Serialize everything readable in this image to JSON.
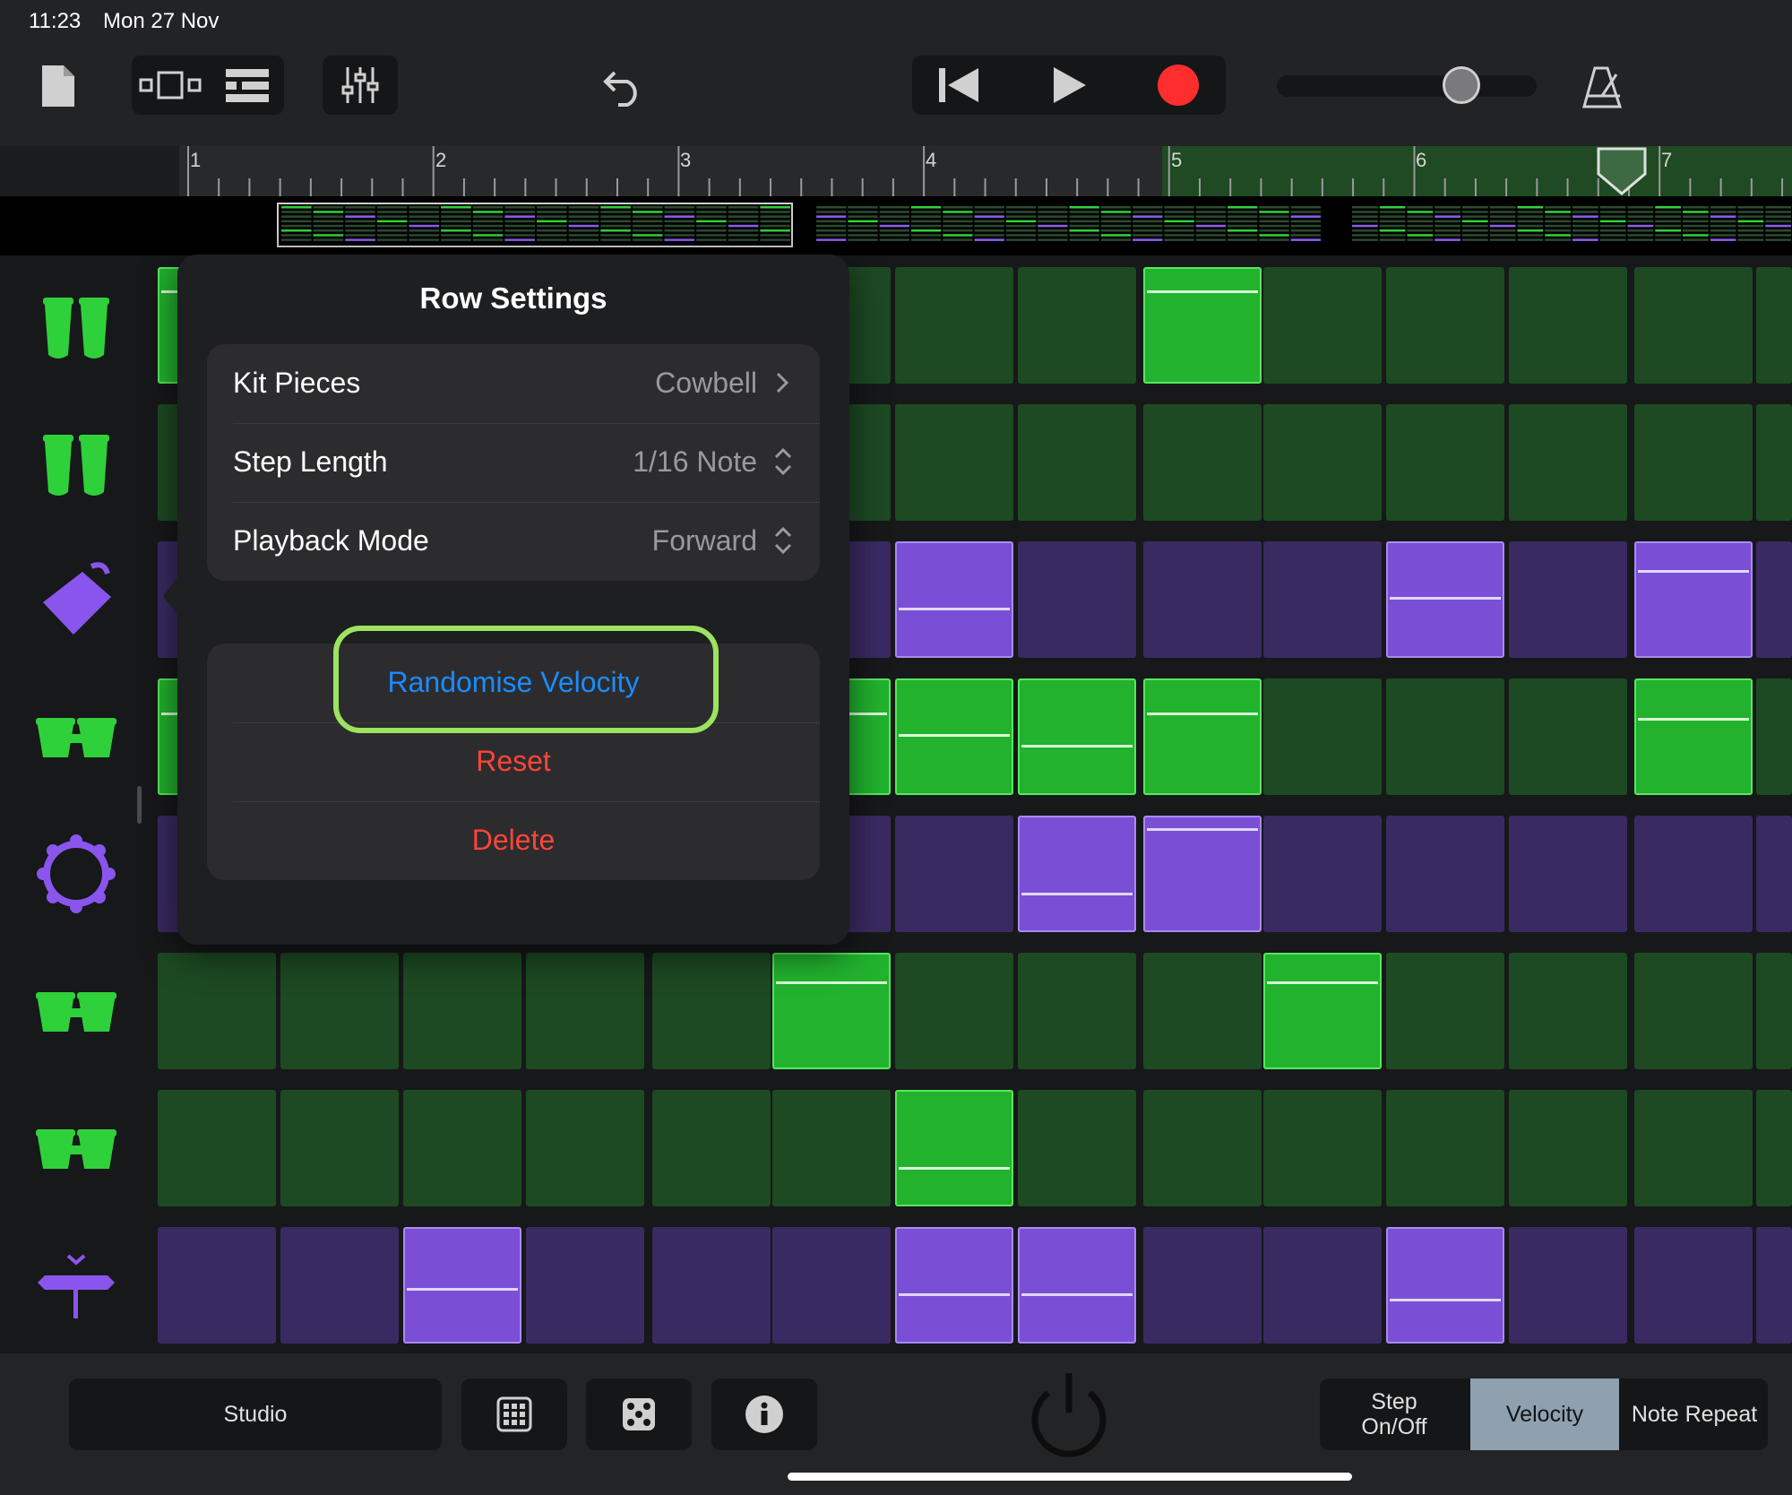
{
  "status": {
    "time": "11:23",
    "date": "Mon 27 Nov"
  },
  "toolbar": {
    "icons": [
      "document-icon",
      "view-toggle-icon",
      "tracks-icon",
      "mixer-icon",
      "undo-icon",
      "rewind-icon",
      "play-icon",
      "record-icon",
      "volume-slider",
      "metronome-icon"
    ],
    "record_color": "#ff2d2d"
  },
  "ruler": {
    "bars": [
      "1",
      "2",
      "3",
      "4",
      "5",
      "6",
      "7"
    ]
  },
  "colors": {
    "green_on": "#22b22e",
    "green_off": "#1d4a22",
    "purple_on": "#7a4fd6",
    "purple_off": "#3a2a62",
    "accent_blue": "#1a8cff",
    "destructive_red": "#ff453a",
    "highlight": "#9de35f"
  },
  "rows": [
    {
      "icon": "conga-icon",
      "color": "green",
      "on": [
        0,
        8
      ],
      "vel": [
        0.2,
        0.2
      ]
    },
    {
      "icon": "conga-icon",
      "color": "green",
      "on": [],
      "vel": []
    },
    {
      "icon": "cowbell-icon",
      "color": "purple",
      "on": [
        6,
        10,
        12
      ],
      "vel": [
        0.6,
        0.5,
        0.25
      ]
    },
    {
      "icon": "bongo-icon",
      "color": "green",
      "on": [
        0,
        5,
        6,
        7,
        8,
        12
      ],
      "vel": [
        0.3,
        0.3,
        0.5,
        0.6,
        0.3,
        0.35
      ]
    },
    {
      "icon": "tambourine-icon",
      "color": "purple",
      "on": [
        7,
        8
      ],
      "vel": [
        0.7,
        0.1
      ]
    },
    {
      "icon": "bongo-icon",
      "color": "green",
      "on": [
        5,
        9
      ],
      "vel": [
        0.25,
        0.25
      ]
    },
    {
      "icon": "bongo-icon",
      "color": "green",
      "on": [
        6
      ],
      "vel": [
        0.7
      ]
    },
    {
      "icon": "shaker-icon",
      "color": "purple",
      "on": [
        2,
        6,
        7,
        10
      ],
      "vel": [
        0.55,
        0.6,
        0.6,
        0.65
      ]
    }
  ],
  "popup": {
    "title": "Row Settings",
    "kit_pieces_label": "Kit Pieces",
    "kit_pieces_value": "Cowbell",
    "step_length_label": "Step Length",
    "step_length_value": "1/16 Note",
    "playback_mode_label": "Playback Mode",
    "playback_mode_value": "Forward",
    "randomise_velocity": "Randomise Velocity",
    "reset": "Reset",
    "delete": "Delete"
  },
  "bottombar": {
    "studio": "Studio",
    "grid_icon": "grid-icon",
    "dice_icon": "dice-icon",
    "info_icon": "info-icon",
    "power_icon": "power-icon",
    "step_onoff_1": "Step",
    "step_onoff_2": "On/Off",
    "velocity": "Velocity",
    "note_repeat": "Note Repeat",
    "selected_mode": "Velocity"
  }
}
